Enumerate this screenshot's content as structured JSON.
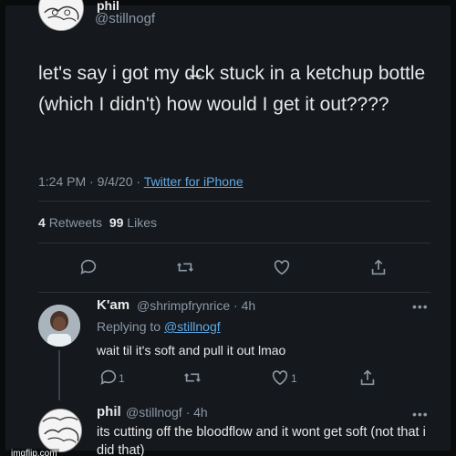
{
  "top_tweet": {
    "display_name": "phil",
    "handle": "@stillnogf",
    "text": "let's say i got my d̶̶ck stuck in a ketchup bottle (which I didn't) how would I get it out????",
    "time": "1:24 PM · 9/4/20 · ",
    "source": "Twitter for iPhone",
    "retweets_count": "4",
    "retweets_label": "Retweets",
    "likes_count": "99",
    "likes_label": "Likes"
  },
  "reply_1": {
    "display_name": "K'am",
    "handle": "@shrimpfrynrice",
    "age": "· 4h",
    "more": "•••",
    "replying_prefix": "Replying to ",
    "replying_mention": "@stillnogf",
    "text": "wait til it's soft and pull it out lmao",
    "reply_count": "1",
    "like_count": "1"
  },
  "reply_2": {
    "display_name": "phil",
    "handle": "@stillnogf",
    "age": "· 4h",
    "more": "•••",
    "text": "its cutting off the bloodflow and it wont get soft (not that i did that)"
  },
  "watermark": "imgflip.com",
  "colors": {
    "background": "#15181c",
    "link": "#5fa9e6",
    "muted": "#8b98a5",
    "text": "#e7e9ea"
  },
  "icons": [
    "reply-icon",
    "retweet-icon",
    "like-icon",
    "share-icon"
  ]
}
